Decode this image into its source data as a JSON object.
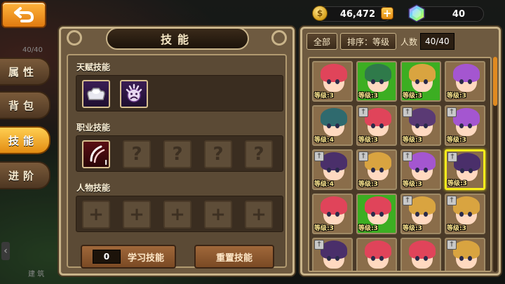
{
  "topbar": {
    "gold": "46,472",
    "gems": "40",
    "coin_symbol": "$",
    "plus_symbol": "+"
  },
  "sidebar": {
    "tabs": [
      {
        "label": "属性"
      },
      {
        "label": "背包"
      },
      {
        "label": "技能",
        "active": true
      },
      {
        "label": "进阶"
      }
    ],
    "dim_labels": [
      "40/40",
      "建 筑"
    ]
  },
  "skill_panel": {
    "title": "技能",
    "talent_label": "天赋技能",
    "job_label": "职业技能",
    "char_label": "人物技能",
    "job_skill_level": "I",
    "locked_symbol": "?",
    "empty_symbol": "+",
    "learn_count": "0",
    "learn_button": "学习技能",
    "reset_button": "重置技能"
  },
  "hero_panel": {
    "all_button": "全部",
    "sort_button": "排序：等级",
    "count_label": "人数",
    "count_value": "40/40",
    "heroes": [
      {
        "level": "等级:3",
        "hair": "#e0445a",
        "bg": "#8a6d4a"
      },
      {
        "level": "等级:3",
        "hair": "#2f7a4a",
        "bg": "#3cae22"
      },
      {
        "level": "等级:3",
        "hair": "#d9a440",
        "bg": "#3cae22"
      },
      {
        "level": "等级:3",
        "hair": "#a456d0",
        "bg": "#8a6d4a"
      },
      {
        "level": "等级:4",
        "hair": "#2f6a6e",
        "bg": "#8a6d4a"
      },
      {
        "level": "等级:3",
        "hair": "#e0445a",
        "bg": "#8a6d4a",
        "badge": "†"
      },
      {
        "level": "等级:3",
        "hair": "#5a3a74",
        "bg": "#8a6d4a",
        "badge": "†"
      },
      {
        "level": "等级:3",
        "hair": "#a456d0",
        "bg": "#8a6d4a",
        "badge": "†"
      },
      {
        "level": "等级:4",
        "hair": "#4a2f6a",
        "bg": "#8a6d4a",
        "badge": "†"
      },
      {
        "level": "等级:3",
        "hair": "#d9a440",
        "bg": "#8a6d4a",
        "badge": "†"
      },
      {
        "level": "等级:3",
        "hair": "#a456d0",
        "bg": "#8a6d4a",
        "badge": "†"
      },
      {
        "level": "等级:3",
        "hair": "#4a2f6a",
        "bg": "#8a6d4a",
        "badge": "†",
        "selected": true
      },
      {
        "level": "等级:3",
        "hair": "#e0445a",
        "bg": "#8a6d4a"
      },
      {
        "level": "等级:3",
        "hair": "#e0445a",
        "bg": "#3cae22"
      },
      {
        "level": "等级:3",
        "hair": "#d9a440",
        "bg": "#8a6d4a",
        "badge": "†"
      },
      {
        "level": "等级:3",
        "hair": "#d9a440",
        "bg": "#8a6d4a",
        "badge": "†"
      },
      {
        "level": "",
        "hair": "#4a2f6a",
        "bg": "#8a6d4a",
        "badge": "†"
      },
      {
        "level": "",
        "hair": "#e0445a",
        "bg": "#8a6d4a"
      },
      {
        "level": "",
        "hair": "#e0445a",
        "bg": "#8a6d4a"
      },
      {
        "level": "",
        "hair": "#d9a440",
        "bg": "#8a6d4a",
        "badge": "†"
      }
    ]
  }
}
